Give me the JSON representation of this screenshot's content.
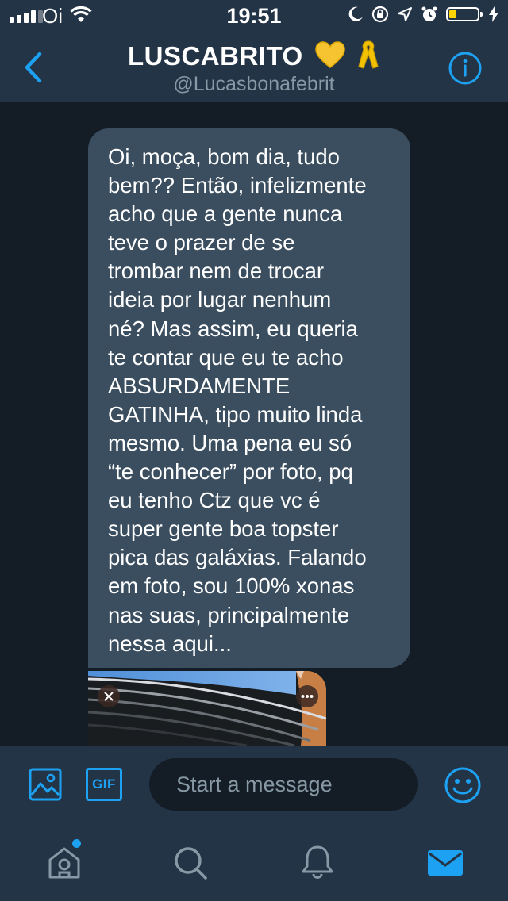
{
  "status_bar": {
    "carrier": "Oi",
    "time": "19:51",
    "battery_level": 0.25,
    "battery_color": "#ffd400"
  },
  "header": {
    "display_name": "LUSCABRITO",
    "display_name_emojis": [
      "yellow-heart-icon",
      "yellow-ribbon-icon"
    ],
    "handle": "@Lucasbonafebrit",
    "back_icon": "chevron-left-icon",
    "info_icon": "info-icon",
    "accent_color": "#1da1f2"
  },
  "conversation": {
    "message_lines": [
      "Oi, moça, bom dia, tudo",
      "bem?? Então, infelizmente",
      "acho que a gente nunca",
      "teve o prazer de se",
      "trombar nem de trocar",
      "ideia por lugar nenhum",
      "né? Mas assim, eu queria",
      "te contar que eu te acho",
      "ABSURDAMENTE",
      "GATINHA, tipo muito linda",
      "mesmo. Uma pena eu só",
      "“te conhecer” por foto, pq",
      "eu tenho Ctz que vc é",
      "super gente boa topster",
      "pica das galáxias. Falando",
      "em foto, sou 100% xonas",
      "nas suas, principalmente",
      "nessa aqui..."
    ],
    "bubble_color": "#3b4e5f",
    "attachment": {
      "type": "photo",
      "close_icon": "close-icon",
      "more_icon": "more-options-icon"
    }
  },
  "composer": {
    "placeholder": "Start a message",
    "photo_icon": "image-icon",
    "gif_label": "GIF",
    "emoji_icon": "smiley-icon"
  },
  "tab_bar": {
    "tabs": [
      {
        "name": "home",
        "icon": "home-icon",
        "has_notification_dot": true
      },
      {
        "name": "search",
        "icon": "search-icon"
      },
      {
        "name": "notifications",
        "icon": "bell-icon"
      },
      {
        "name": "messages",
        "icon": "envelope-icon",
        "active": true
      }
    ],
    "active_color": "#1da1f2",
    "inactive_color": "#8899a6"
  }
}
